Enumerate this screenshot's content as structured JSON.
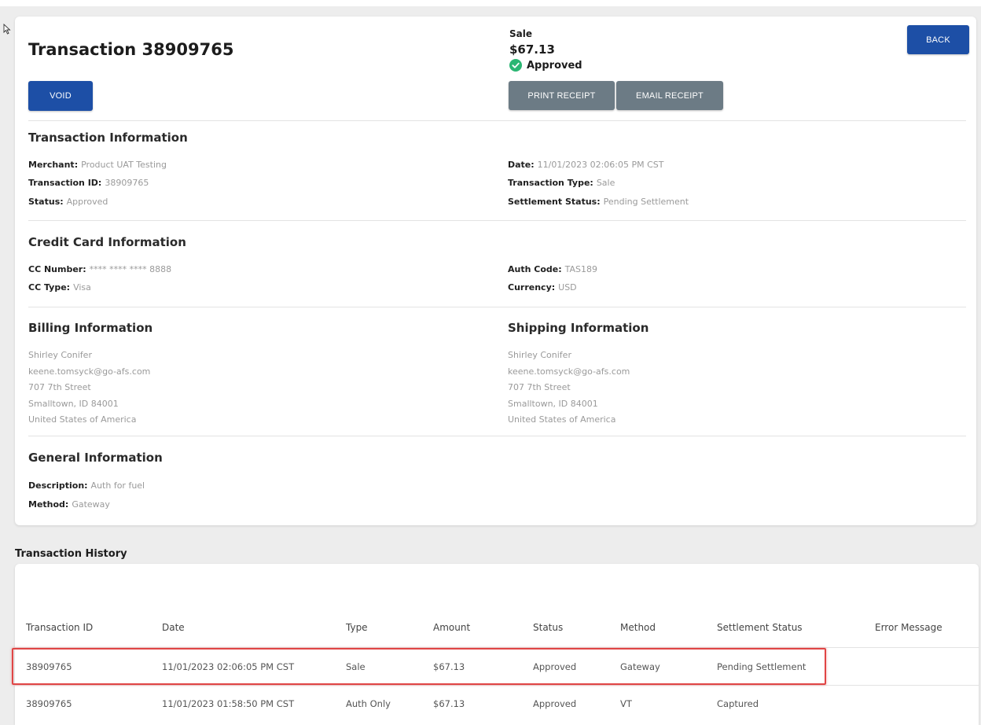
{
  "header": {
    "title": "Transaction 38909765",
    "void_label": "VOID",
    "back_label": "BACK",
    "print_label": "PRINT RECEIPT",
    "email_label": "EMAIL RECEIPT"
  },
  "summary": {
    "type": "Sale",
    "amount": "$67.13",
    "status": "Approved"
  },
  "transaction_info": {
    "title": "Transaction Information",
    "merchant_label": "Merchant:",
    "merchant": "Product UAT Testing",
    "id_label": "Transaction ID:",
    "id": "38909765",
    "status_label": "Status:",
    "status": "Approved",
    "date_label": "Date:",
    "date": "11/01/2023 02:06:05 PM CST",
    "type_label": "Transaction Type:",
    "type": "Sale",
    "settlement_label": "Settlement Status:",
    "settlement": "Pending Settlement"
  },
  "card_info": {
    "title": "Credit Card Information",
    "number_label": "CC Number:",
    "number": "**** **** **** 8888",
    "type_label": "CC Type:",
    "type": "Visa",
    "auth_label": "Auth Code:",
    "auth": "TAS189",
    "currency_label": "Currency:",
    "currency": "USD"
  },
  "billing": {
    "title": "Billing Information",
    "lines": [
      "Shirley Conifer",
      "keene.tomsyck@go-afs.com",
      "707 7th Street",
      "Smalltown, ID 84001",
      "United States of America"
    ]
  },
  "shipping": {
    "title": "Shipping Information",
    "lines": [
      "Shirley Conifer",
      "keene.tomsyck@go-afs.com",
      "707 7th Street",
      "Smalltown, ID 84001",
      "United States of America"
    ]
  },
  "general": {
    "title": "General Information",
    "description_label": "Description:",
    "description": "Auth for fuel",
    "method_label": "Method:",
    "method": "Gateway"
  },
  "history": {
    "title": "Transaction History",
    "columns": [
      "Transaction ID",
      "Date",
      "Type",
      "Amount",
      "Status",
      "Method",
      "Settlement Status",
      "Error Message"
    ],
    "rows": [
      [
        "38909765",
        "11/01/2023 02:06:05 PM CST",
        "Sale",
        "$67.13",
        "Approved",
        "Gateway",
        "Pending Settlement",
        ""
      ],
      [
        "38909765",
        "11/01/2023 01:58:50 PM CST",
        "Auth Only",
        "$67.13",
        "Approved",
        "VT",
        "Captured",
        ""
      ]
    ]
  },
  "colors": {
    "primary_button": "#1d4fa6",
    "secondary_button": "#6c7b85",
    "approved": "#2bb673",
    "highlight": "#e04545"
  }
}
